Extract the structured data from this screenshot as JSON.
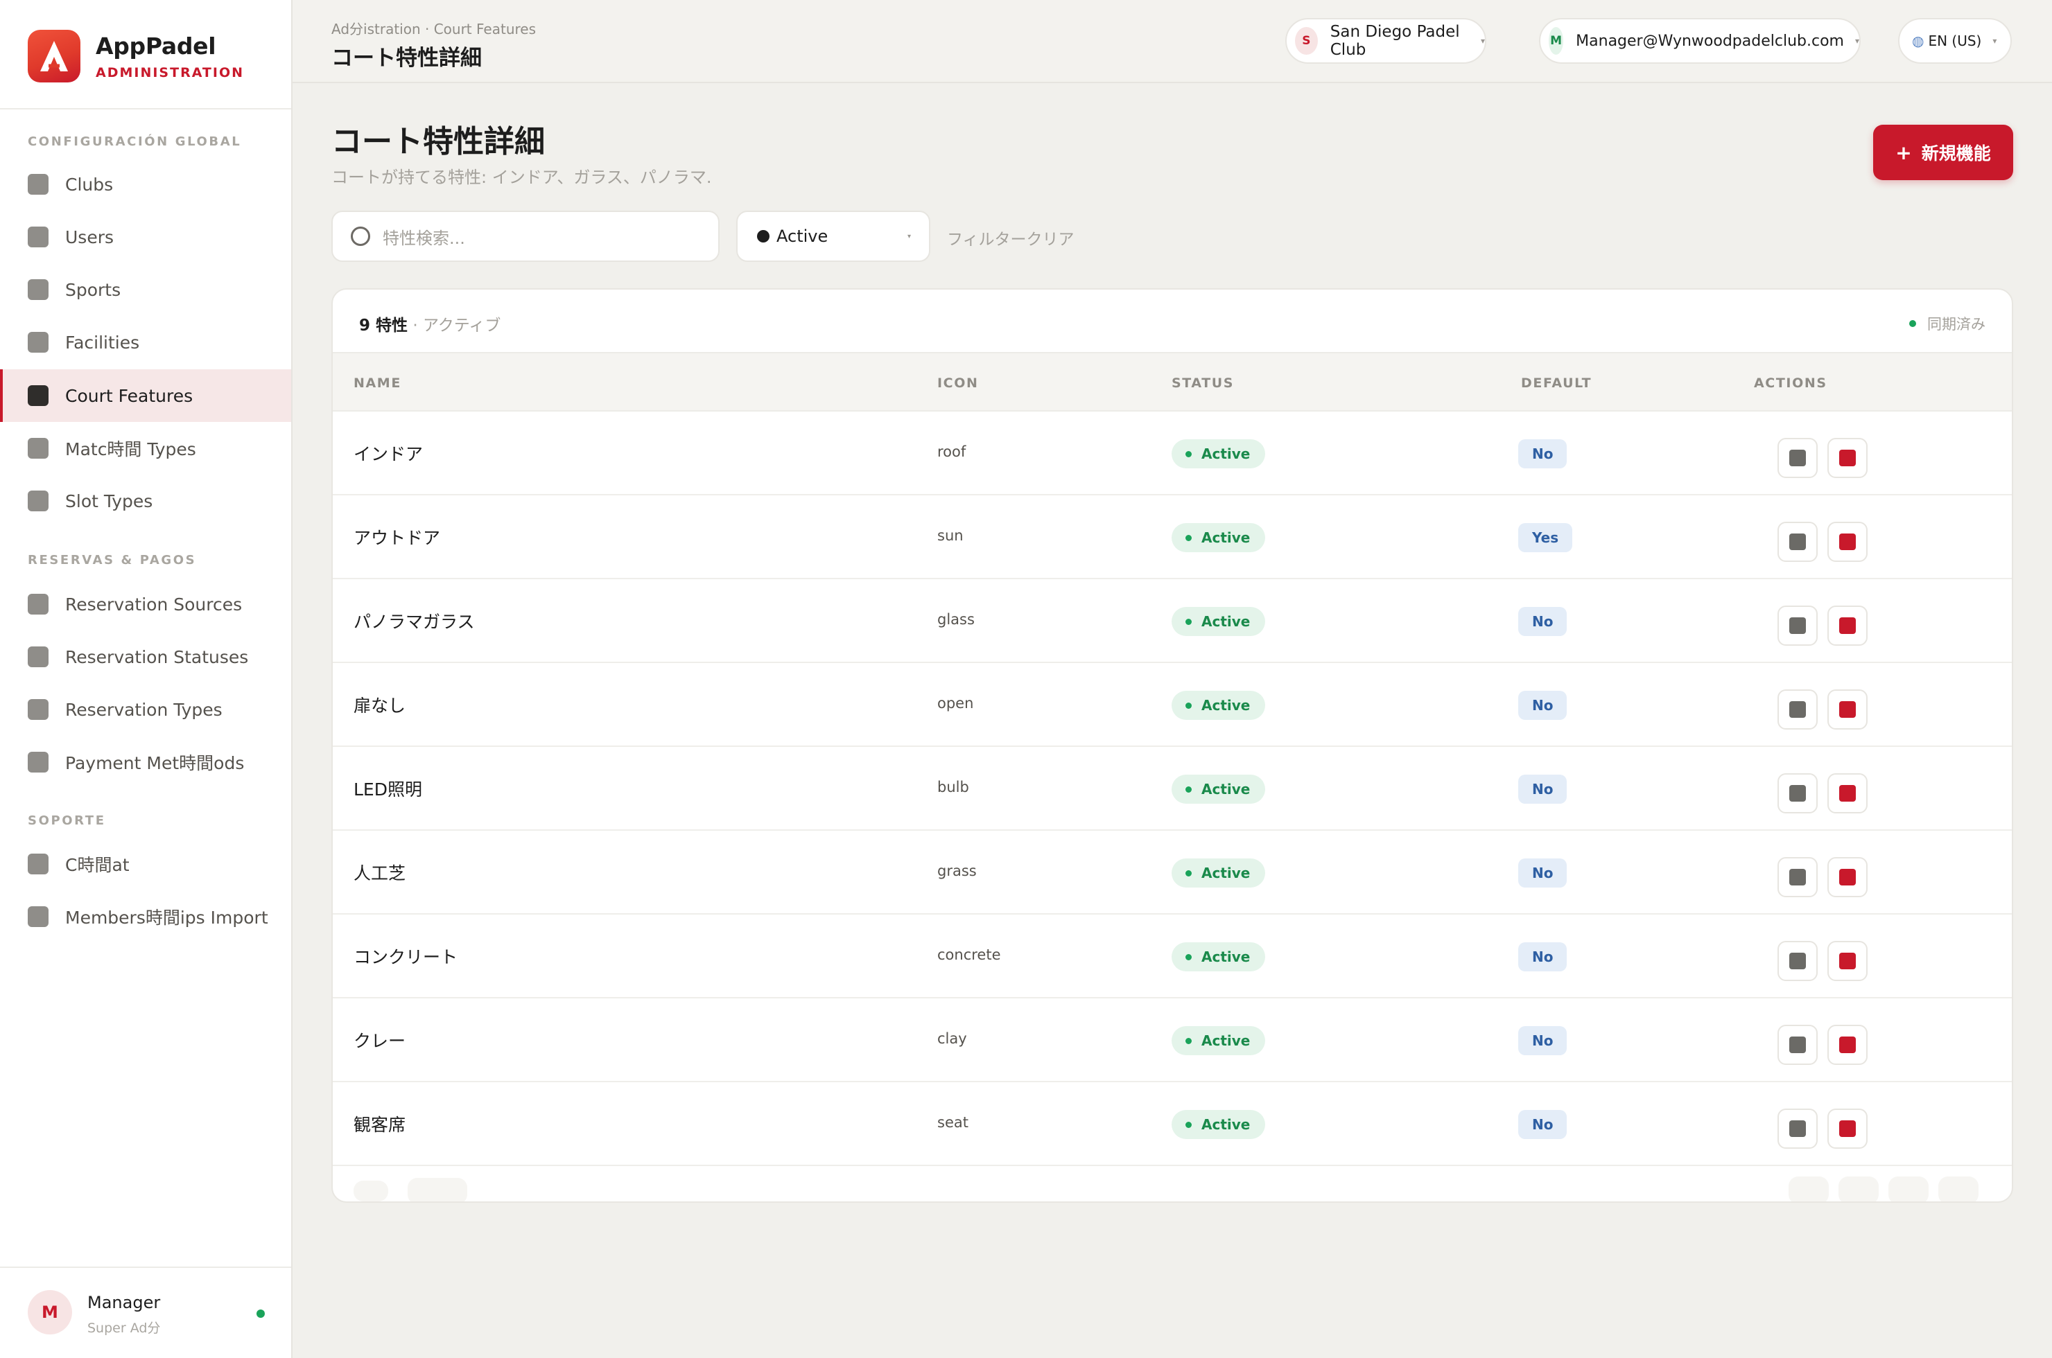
{
  "brand": {
    "name": "AppPadel",
    "subtitle": "ADMINISTRATION",
    "logo_color": "#e03a2b"
  },
  "sidebar": {
    "sections": [
      {
        "title": "CONFIGURACIÓN GLOBAL",
        "items": [
          "Clubs",
          "Users",
          "Sports",
          "Facilities",
          "Court Features",
          "Matc時間 Types",
          "Slot Types"
        ]
      },
      {
        "title": "RESERVAS & PAGOS",
        "items": [
          "Reservation Sources",
          "Reservation Statuses",
          "Reservation Types",
          "Payment Met時間ods"
        ]
      },
      {
        "title": "SOPORTE",
        "items": [
          "C時間at",
          "Members時間ips Import"
        ]
      }
    ],
    "active_item": "Court Features",
    "user": {
      "initial": "M",
      "name": "Manager",
      "role": "Super Ad分",
      "online": true
    }
  },
  "topbar": {
    "breadcrumb": "Ad分istration · Court Features",
    "title": "コート特性詳細",
    "club": {
      "initial": "S",
      "label": "San Diego Padel Club"
    },
    "account": {
      "initial": "M",
      "label": "Manager@Wynwoodpadelclub.com"
    },
    "language": {
      "icon": "globe-icon",
      "label": "EN (US)"
    }
  },
  "page": {
    "title": "コート特性詳細",
    "description": "コートが持てる特性: インドア、ガラス、パノラマ.",
    "new_button": "新規機能",
    "search_placeholder": "特性検索...",
    "status_filter": "Active",
    "clear_filters": "フィルタークリア"
  },
  "table": {
    "count_label": "9 特性",
    "count_suffix": " · アクティブ",
    "sync_label": "同期済み",
    "columns": {
      "name": "NAME",
      "icon": "ICON",
      "status": "STATUS",
      "default": "DEFAULT",
      "actions": "ACTIONS"
    },
    "rows": [
      {
        "name": "インドア",
        "icon": "roof",
        "status": "Active",
        "default": "No"
      },
      {
        "name": "アウトドア",
        "icon": "sun",
        "status": "Active",
        "default": "Yes"
      },
      {
        "name": "パノラマガラス",
        "icon": "glass",
        "status": "Active",
        "default": "No"
      },
      {
        "name": "扉なし",
        "icon": "open",
        "status": "Active",
        "default": "No"
      },
      {
        "name": "LED照明",
        "icon": "bulb",
        "status": "Active",
        "default": "No"
      },
      {
        "name": "人工芝",
        "icon": "grass",
        "status": "Active",
        "default": "No"
      },
      {
        "name": "コンクリート",
        "icon": "concrete",
        "status": "Active",
        "default": "No"
      },
      {
        "name": "クレー",
        "icon": "clay",
        "status": "Active",
        "default": "No"
      },
      {
        "name": "観客席",
        "icon": "seat",
        "status": "Active",
        "default": "No"
      }
    ]
  },
  "colors": {
    "accent": "#c8192b",
    "status_active": "#1a8a4b",
    "default_badge": "#2e5fa3",
    "edit_action": "#6b6a66",
    "delete_action": "#c8192b"
  }
}
